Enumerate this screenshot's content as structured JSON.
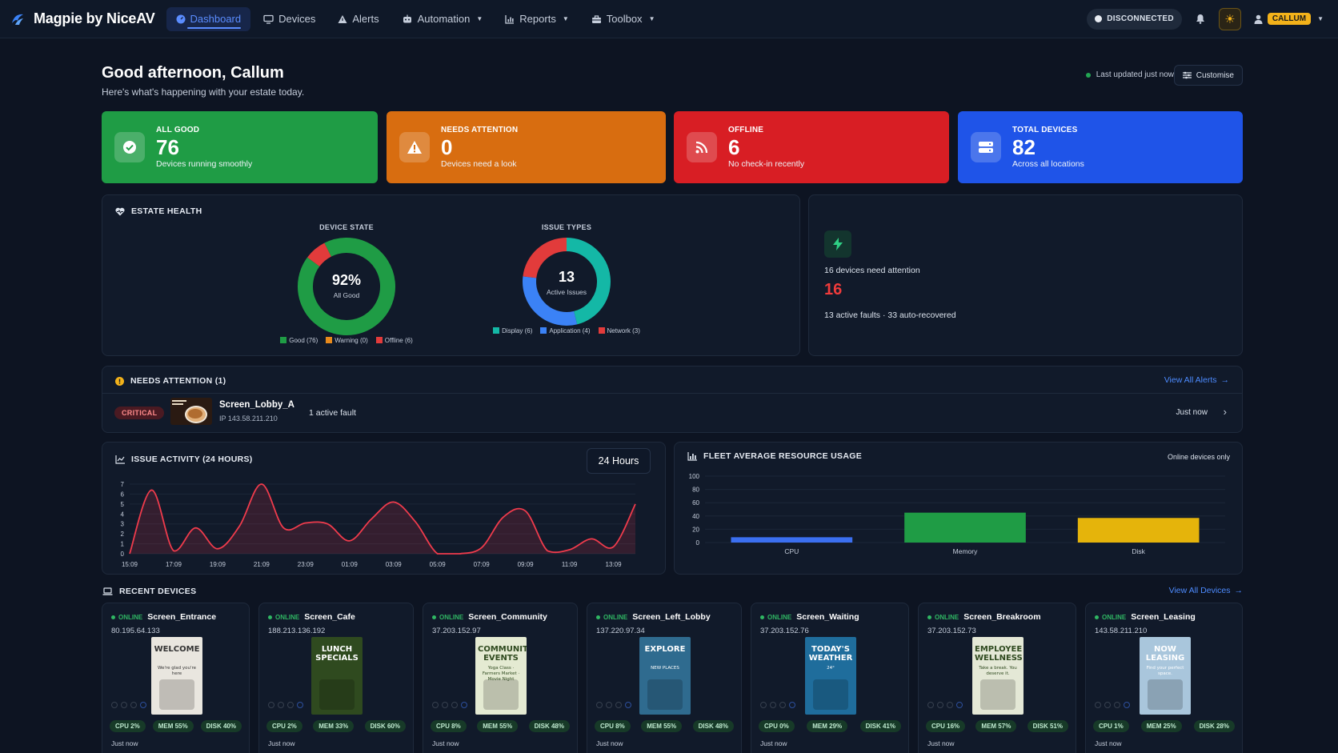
{
  "app": {
    "name": "Magpie by NiceAV"
  },
  "nav": [
    {
      "label": "Dashboard",
      "icon": "dashboard-icon",
      "active": true,
      "dropdown": false
    },
    {
      "label": "Devices",
      "icon": "monitor-icon",
      "active": false,
      "dropdown": false
    },
    {
      "label": "Alerts",
      "icon": "warning-icon",
      "active": false,
      "dropdown": false
    },
    {
      "label": "Automation",
      "icon": "robot-icon",
      "active": false,
      "dropdown": true
    },
    {
      "label": "Reports",
      "icon": "chart-icon",
      "active": false,
      "dropdown": true
    },
    {
      "label": "Toolbox",
      "icon": "toolbox-icon",
      "active": false,
      "dropdown": true
    }
  ],
  "topbar": {
    "status": "DISCONNECTED",
    "user": "CALLUM"
  },
  "greeting": {
    "title": "Good afternoon, Callum",
    "subtitle": "Here's what's happening with your estate today.",
    "updated": "Last updated just now",
    "customise": "Customise"
  },
  "stats": [
    {
      "label": "ALL GOOD",
      "value": "76",
      "sub": "Devices running smoothly",
      "color": "#1f9c45",
      "icon": "check-circle-icon"
    },
    {
      "label": "NEEDS ATTENTION",
      "value": "0",
      "sub": "Devices need a look",
      "color": "#d86d10",
      "icon": "warning-triangle-icon"
    },
    {
      "label": "OFFLINE",
      "value": "6",
      "sub": "No check-in recently",
      "color": "#d81e24",
      "icon": "signal-icon"
    },
    {
      "label": "TOTAL DEVICES",
      "value": "82",
      "sub": "Across all locations",
      "color": "#1f54e8",
      "icon": "server-icon"
    }
  ],
  "estate": {
    "title": "ESTATE HEALTH",
    "device_state": {
      "title": "DEVICE STATE",
      "center": "92%",
      "center_sub": "All Good",
      "legend": [
        {
          "label": "Good (76)",
          "color": "#1f9c45"
        },
        {
          "label": "Warning (0)",
          "color": "#e88a1c"
        },
        {
          "label": "Offline (6)",
          "color": "#e23b3b"
        }
      ]
    },
    "issue_types": {
      "title": "ISSUE TYPES",
      "center": "13",
      "center_sub": "Active Issues",
      "legend": [
        {
          "label": "Display (6)",
          "color": "#14b8a6"
        },
        {
          "label": "Application (4)",
          "color": "#3b82f6"
        },
        {
          "label": "Network (3)",
          "color": "#e23b3b"
        }
      ]
    },
    "summary": {
      "headline": "16 devices need attention",
      "count": "16",
      "detail": "13 active faults · 33 auto-recovered"
    }
  },
  "attention": {
    "title": "NEEDS ATTENTION (1)",
    "link": "View All Alerts",
    "rows": [
      {
        "severity": "CRITICAL",
        "name": "Screen_Lobby_A",
        "ip": "IP 143.58.211.210",
        "fault": "1 active fault",
        "time": "Just now"
      }
    ]
  },
  "activity": {
    "title": "ISSUE ACTIVITY (24 HOURS)",
    "range": "24 Hours"
  },
  "resources": {
    "title": "FLEET AVERAGE RESOURCE USAGE",
    "note": "Online devices only"
  },
  "chart_data": [
    {
      "type": "pie",
      "title": "DEVICE STATE",
      "categories": [
        "Good",
        "Warning",
        "Offline"
      ],
      "values": [
        76,
        0,
        6
      ]
    },
    {
      "type": "pie",
      "title": "ISSUE TYPES",
      "categories": [
        "Display",
        "Application",
        "Network"
      ],
      "values": [
        6,
        4,
        3
      ]
    },
    {
      "type": "line",
      "title": "ISSUE ACTIVITY (24 HOURS)",
      "x": [
        "15:09",
        "16:09",
        "17:09",
        "18:09",
        "19:09",
        "20:09",
        "21:09",
        "22:09",
        "23:09",
        "00:09",
        "01:09",
        "02:09",
        "03:09",
        "04:09",
        "05:09",
        "06:09",
        "07:09",
        "08:09",
        "09:09",
        "10:09",
        "11:09",
        "12:09",
        "13:09",
        "14:09"
      ],
      "xticks": [
        "15:09",
        "17:09",
        "19:09",
        "21:09",
        "23:09",
        "01:09",
        "03:09",
        "05:09",
        "07:09",
        "09:09",
        "11:09",
        "13:09"
      ],
      "values": [
        0,
        6.4,
        0.3,
        2.6,
        0.5,
        2.8,
        7,
        2.6,
        3.1,
        3,
        1.3,
        3.5,
        5.2,
        3.2,
        0,
        0,
        0.6,
        3.7,
        4.3,
        0.3,
        0.4,
        1.5,
        0.7,
        5
      ],
      "ylim": [
        0,
        7
      ],
      "yticks": [
        0,
        1,
        2,
        3,
        4,
        5,
        6,
        7
      ],
      "color": "#ef3b4c"
    },
    {
      "type": "bar",
      "title": "FLEET AVERAGE RESOURCE USAGE",
      "categories": [
        "CPU",
        "Memory",
        "Disk"
      ],
      "values": [
        8,
        45,
        37
      ],
      "colors": [
        "#3b6ff0",
        "#1f9c45",
        "#e5b40b"
      ],
      "ylim": [
        0,
        100
      ],
      "yticks": [
        0,
        20,
        40,
        60,
        80,
        100
      ]
    }
  ],
  "recent": {
    "title": "RECENT DEVICES",
    "link": "View All Devices",
    "devices": [
      {
        "status": "ONLINE",
        "name": "Screen_Entrance",
        "ip": "80.195.64.133",
        "cpu": "CPU 2%",
        "mem": "MEM 55%",
        "disk": "DISK 40%",
        "time": "Just now",
        "thumb_title": "WELCOME",
        "thumb_sub": "We're glad you're here",
        "thumb_bg": "#e9e6df",
        "thumb_fg": "#333333"
      },
      {
        "status": "ONLINE",
        "name": "Screen_Cafe",
        "ip": "188.213.136.192",
        "cpu": "CPU 2%",
        "mem": "MEM 33%",
        "disk": "DISK 60%",
        "time": "Just now",
        "thumb_title": "LUNCH SPECIALS",
        "thumb_sub": "",
        "thumb_bg": "#2f4a1f",
        "thumb_fg": "#ffffff"
      },
      {
        "status": "ONLINE",
        "name": "Screen_Community",
        "ip": "37.203.152.97",
        "cpu": "CPU 8%",
        "mem": "MEM 55%",
        "disk": "DISK 48%",
        "time": "Just now",
        "thumb_title": "COMMUNITY EVENTS",
        "thumb_sub": "Yoga Class · Farmers Market · Movie Night",
        "thumb_bg": "#e4ead2",
        "thumb_fg": "#2f4a1f"
      },
      {
        "status": "ONLINE",
        "name": "Screen_Left_Lobby",
        "ip": "137.220.97.34",
        "cpu": "CPU 8%",
        "mem": "MEM 55%",
        "disk": "DISK 48%",
        "time": "Just now",
        "thumb_title": "EXPLORE",
        "thumb_sub": "NEW PLACES",
        "thumb_bg": "#2f6b8f",
        "thumb_fg": "#ffffff"
      },
      {
        "status": "ONLINE",
        "name": "Screen_Waiting",
        "ip": "37.203.152.76",
        "cpu": "CPU 0%",
        "mem": "MEM 29%",
        "disk": "DISK 41%",
        "time": "Just now",
        "thumb_title": "TODAY'S WEATHER",
        "thumb_sub": "24°",
        "thumb_bg": "#1f6d9c",
        "thumb_fg": "#ffffff"
      },
      {
        "status": "ONLINE",
        "name": "Screen_Breakroom",
        "ip": "37.203.152.73",
        "cpu": "CPU 16%",
        "mem": "MEM 57%",
        "disk": "DISK 51%",
        "time": "Just now",
        "thumb_title": "EMPLOYEE WELLNESS",
        "thumb_sub": "Take a break. You deserve it.",
        "thumb_bg": "#e4e8d6",
        "thumb_fg": "#2f4a1f"
      },
      {
        "status": "ONLINE",
        "name": "Screen_Leasing",
        "ip": "143.58.211.210",
        "cpu": "CPU 1%",
        "mem": "MEM 25%",
        "disk": "DISK 28%",
        "time": "Just now",
        "thumb_title": "NOW LEASING",
        "thumb_sub": "Find your perfect space.",
        "thumb_bg": "#a9c6dc",
        "thumb_fg": "#ffffff"
      }
    ]
  }
}
